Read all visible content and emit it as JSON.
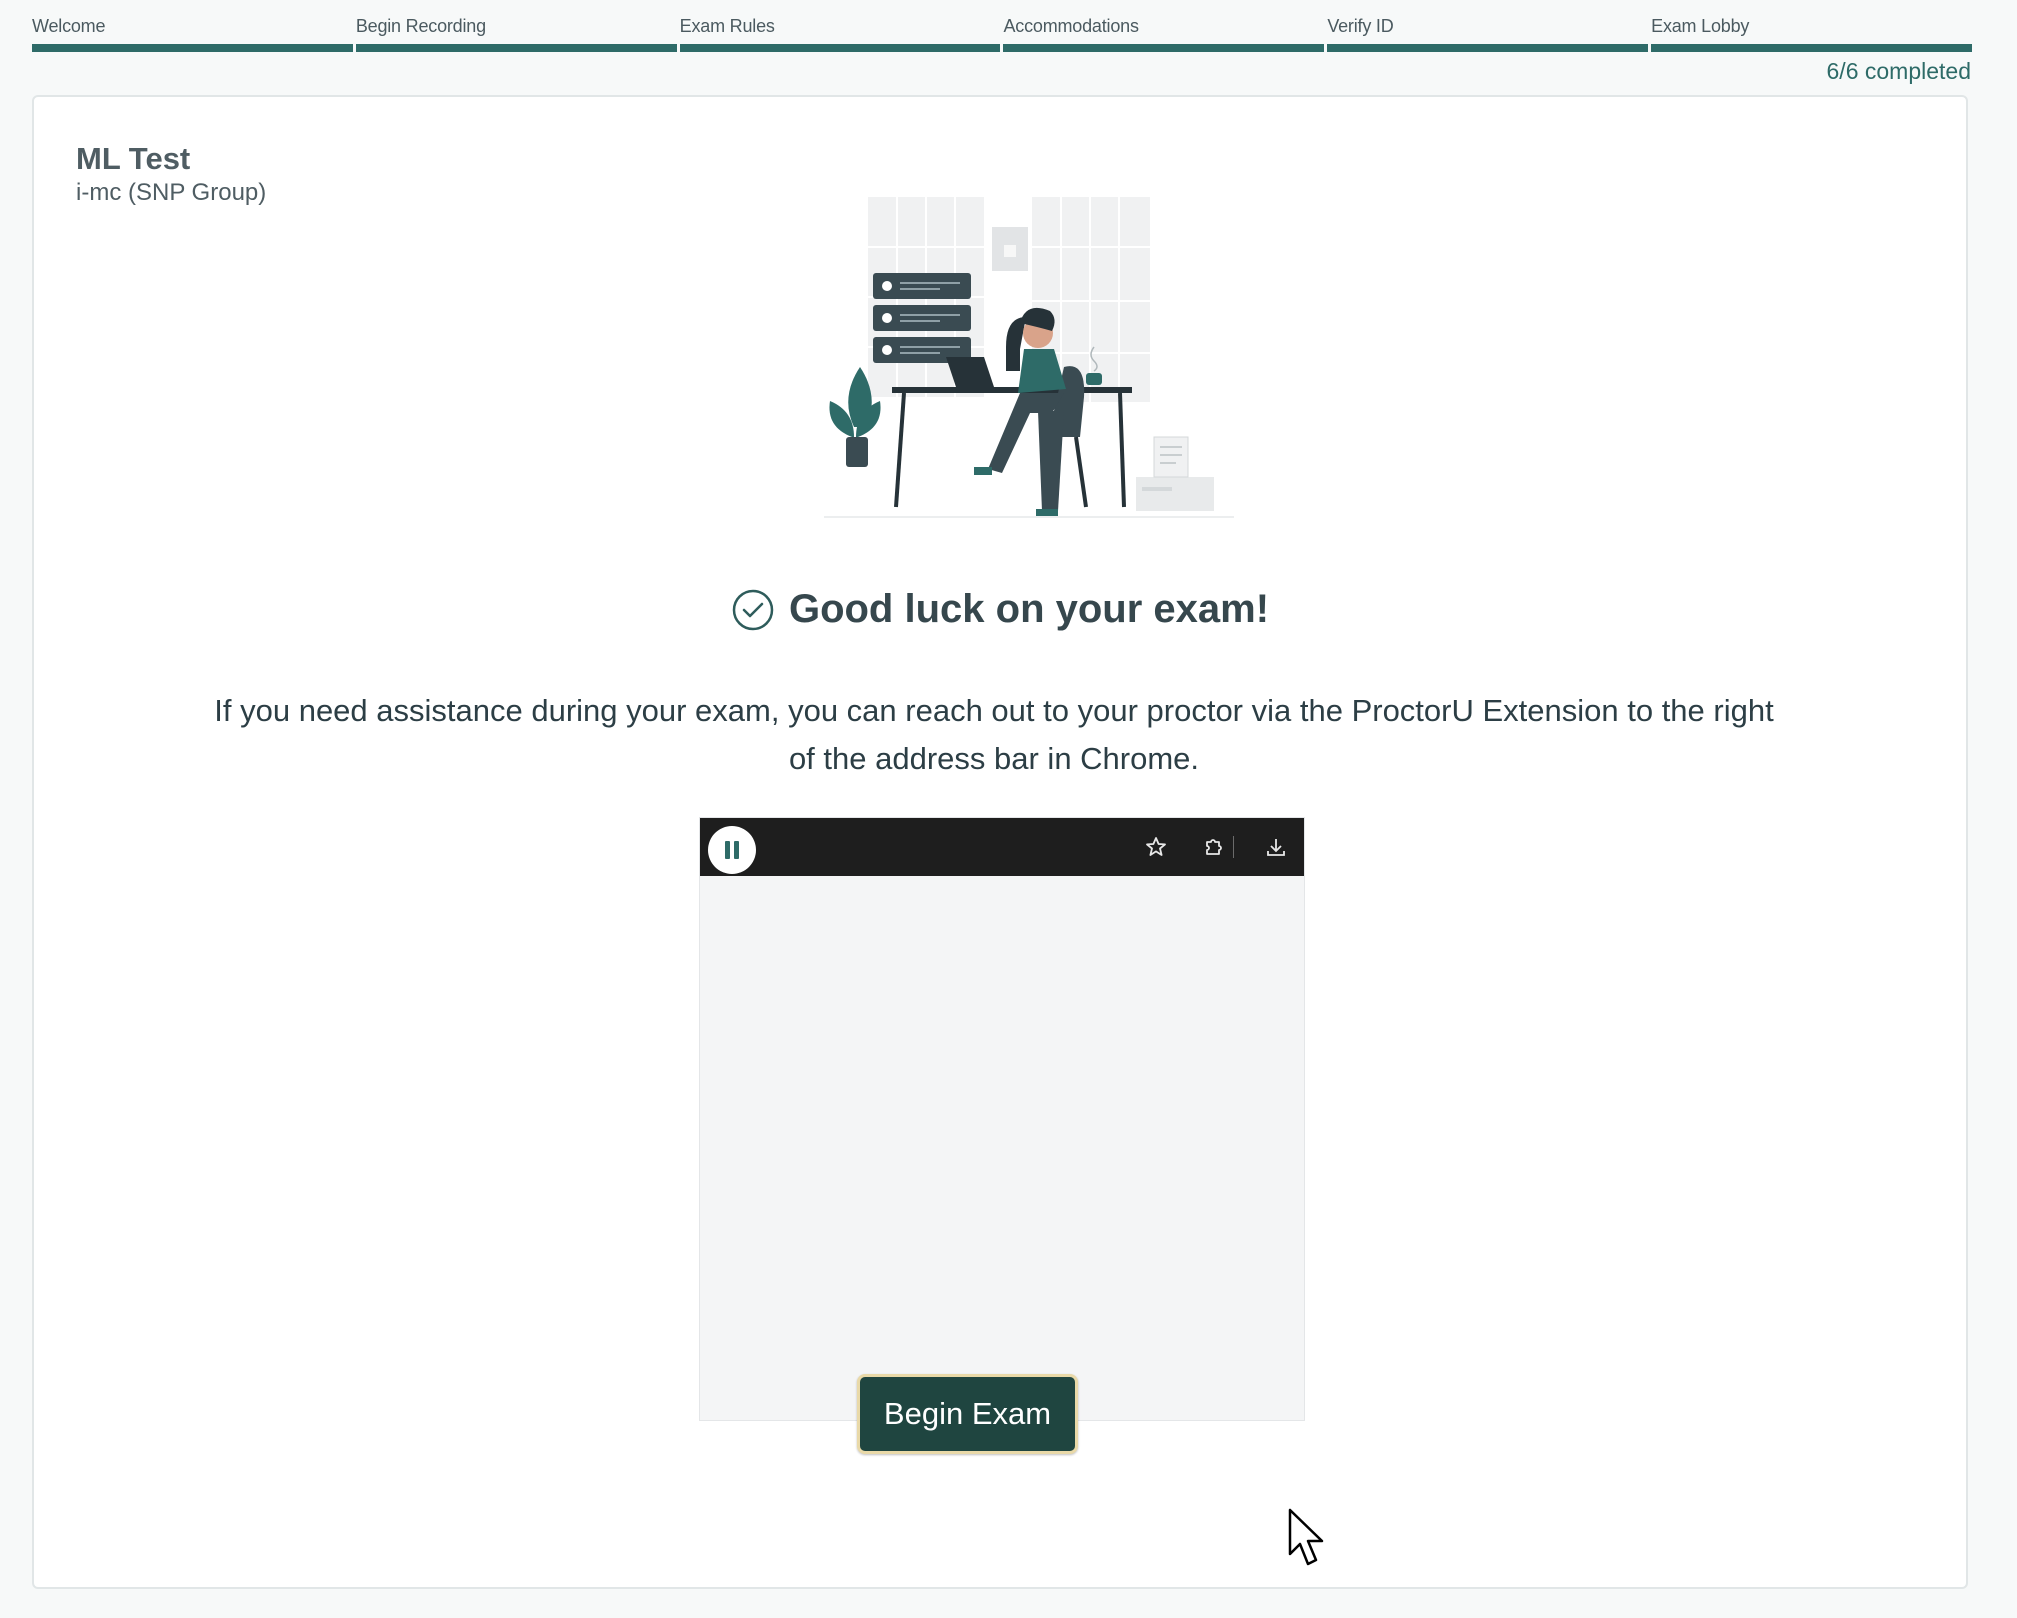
{
  "steps": [
    {
      "label": "Welcome"
    },
    {
      "label": "Begin Recording"
    },
    {
      "label": "Exam Rules"
    },
    {
      "label": "Accommodations"
    },
    {
      "label": "Verify ID"
    },
    {
      "label": "Exam Lobby"
    }
  ],
  "progress": {
    "text": "6/6 completed",
    "completed": 6,
    "total": 6
  },
  "exam": {
    "title": "ML Test",
    "organization": "i-mc (SNP Group)"
  },
  "main": {
    "heading": "Good luck on your exam!",
    "help_text": "If you need assistance during your exam, you can reach out to your proctor via the ProctorU Extension to the right of the address bar in Chrome."
  },
  "browser_mock": {
    "icons": [
      "pause-icon",
      "star-icon",
      "extensions-puzzle-icon",
      "download-icon"
    ]
  },
  "actions": {
    "begin_label": "Begin Exam"
  },
  "colors": {
    "accent": "#2e6b68",
    "button_bg": "#1f4540",
    "button_border": "#e9d9a8",
    "page_bg": "#f7f9f9",
    "browser_bar": "#1e1e1e"
  }
}
